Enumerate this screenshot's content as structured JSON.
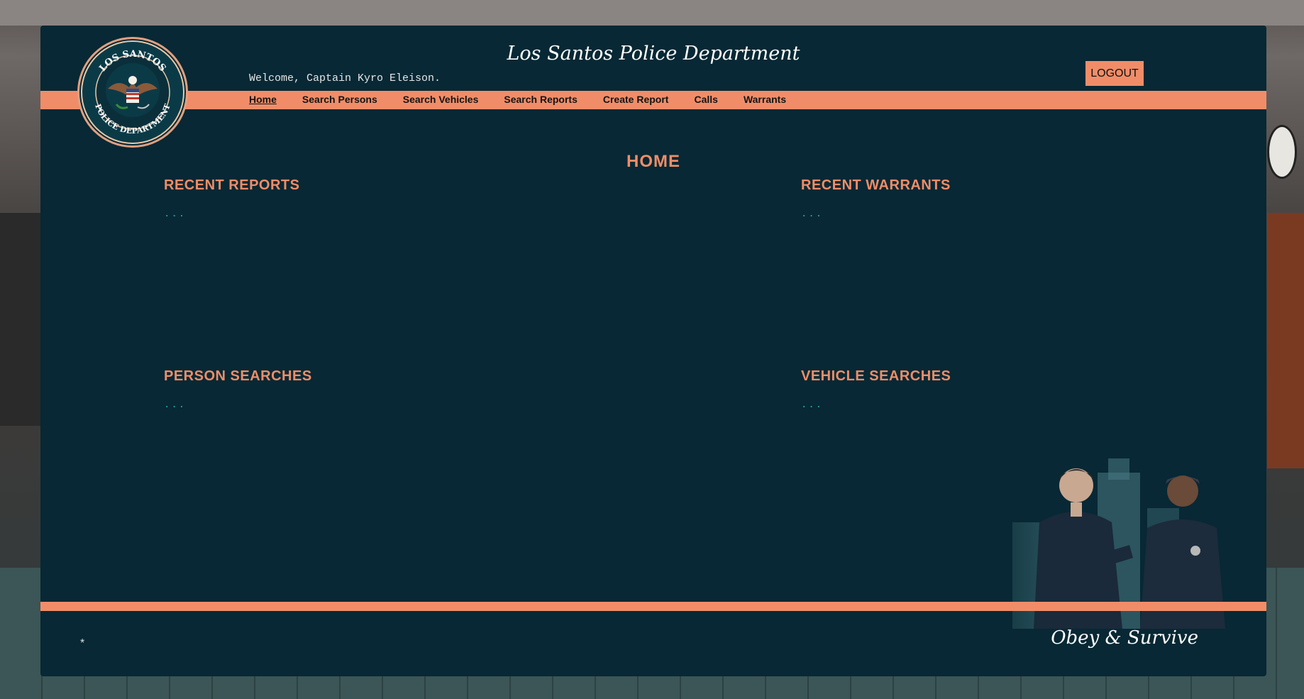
{
  "header": {
    "department_title": "Los Santos Police Department",
    "welcome_text": "Welcome, Captain Kyro Eleison.",
    "logout_label": "LOGOUT",
    "badge_top_text": "LOS SANTOS",
    "badge_bottom_text": "POLICE DEPARTMENT"
  },
  "nav": {
    "items": [
      {
        "label": "Home",
        "active": true
      },
      {
        "label": "Search Persons"
      },
      {
        "label": "Search Vehicles"
      },
      {
        "label": "Search Reports"
      },
      {
        "label": "Create Report"
      },
      {
        "label": "Calls"
      },
      {
        "label": "Warrants"
      }
    ]
  },
  "main": {
    "page_title": "HOME",
    "sections": {
      "recent_reports": {
        "title": "RECENT REPORTS",
        "content": "..."
      },
      "recent_warrants": {
        "title": "RECENT WARRANTS",
        "content": "..."
      },
      "person_searches": {
        "title": "PERSON SEARCHES",
        "content": "..."
      },
      "vehicle_searches": {
        "title": "VEHICLE SEARCHES",
        "content": "..."
      }
    }
  },
  "footer": {
    "marker": "*",
    "motto": "Obey & Survive"
  },
  "colors": {
    "panel_bg": "#072834",
    "accent": "#f08d68",
    "dots": "#2aa8b0"
  }
}
